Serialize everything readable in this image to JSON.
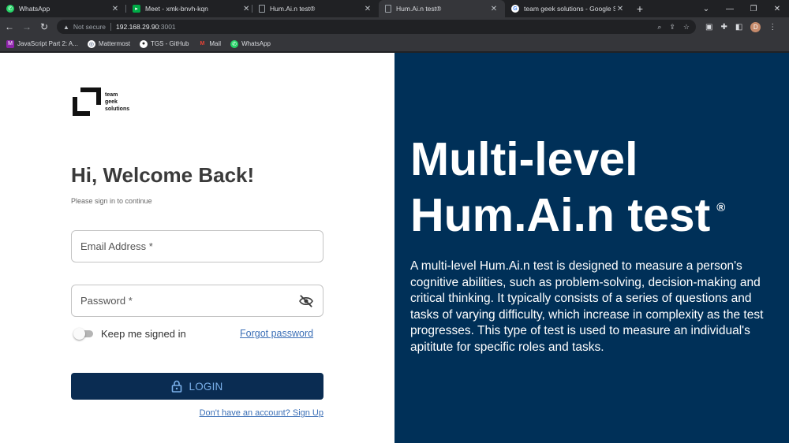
{
  "browser": {
    "tabs": [
      {
        "title": "WhatsApp",
        "icon": "whatsapp-icon",
        "color": "#25d366"
      },
      {
        "title": "Meet - xmk-bnvh-kqn",
        "icon": "meet-icon",
        "color": "#00ac47"
      },
      {
        "title": "",
        "icon": "record-icon",
        "color": "#e8453c"
      },
      {
        "title": "Hum.Ai.n test®",
        "icon": "page-icon",
        "color": "#9aa0a6"
      },
      {
        "title": "Hum.Ai.n test®",
        "icon": "page-icon",
        "color": "#9aa0a6"
      },
      {
        "title": "team geek solutions - Google Se",
        "icon": "google-icon",
        "color": "#4285f4"
      }
    ],
    "address": {
      "not_secure": "Not secure",
      "host": "192.168.29.90",
      "port": ":3001"
    },
    "profile_initial": "D",
    "bookmarks": [
      {
        "label": "JavaScript Part 2: A...",
        "icon": "bookmark-icon",
        "color": "#8e24aa"
      },
      {
        "label": "Mattermost",
        "icon": "mattermost-icon",
        "color": "#1e325c"
      },
      {
        "label": "TGS - GitHub",
        "icon": "github-icon",
        "color": "#333"
      },
      {
        "label": "Mail",
        "icon": "gmail-icon",
        "color": "#ea4335"
      },
      {
        "label": "WhatsApp",
        "icon": "whatsapp-icon",
        "color": "#25d366"
      }
    ]
  },
  "login": {
    "logo_lines": [
      "team",
      "geek",
      "solutions"
    ],
    "title": "Hi, Welcome Back!",
    "subtitle": "Please sign in to continue",
    "email_label": "Email Address *",
    "password_label": "Password *",
    "keep_signed_in": "Keep me signed in",
    "forgot_password": "Forgot password",
    "login_button": "LOGIN",
    "signup_link": "Don't have an account? Sign Up"
  },
  "hero": {
    "line1": "Multi-level",
    "line2": "Hum.Ai.n test",
    "reg": "®",
    "description": "A multi-level Hum.Ai.n test is designed to measure a person's cognitive abilities, such as problem-solving, decision-making and critical thinking. It typically consists of a series of questions and tasks of varying difficulty, which increase in complexity as the test progresses. This type of test is used to measure an individual's apititute for specific roles and tasks."
  },
  "colors": {
    "hero_bg": "#003058",
    "login_button": "#0a2c52",
    "link": "#3b6fb6"
  }
}
